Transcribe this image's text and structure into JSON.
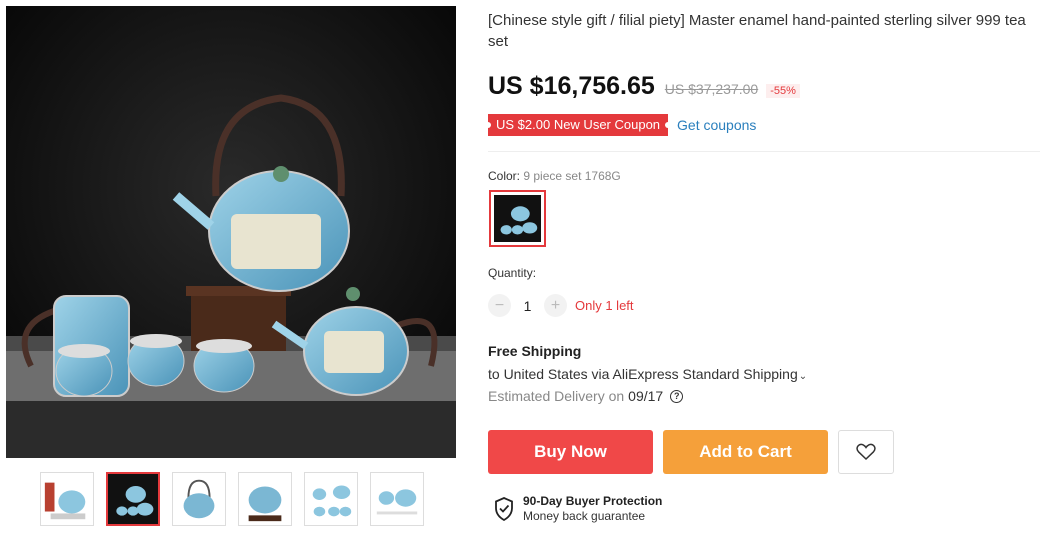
{
  "product": {
    "title": "[Chinese style gift / filial piety] Master enamel hand-painted sterling silver 999 tea set",
    "price": "US $16,756.65",
    "old_price": "US $37,237.00",
    "discount": "-55%",
    "coupon": "US $2.00 New User Coupon",
    "get_coupons": "Get coupons"
  },
  "options": {
    "color_label": "Color:",
    "color_value": "9 piece set 1768G",
    "quantity_label": "Quantity:",
    "quantity": "1",
    "minus": "−",
    "plus": "+",
    "stock_note": "Only 1 left"
  },
  "shipping": {
    "title": "Free Shipping",
    "line": "to United States via AliExpress Standard Shipping",
    "delivery_label": "Estimated Delivery on",
    "delivery_date": "09/17",
    "help": "?"
  },
  "actions": {
    "buy_now": "Buy Now",
    "add_to_cart": "Add to Cart"
  },
  "protection": {
    "title": "90-Day Buyer Protection",
    "subtitle": "Money back guarantee"
  },
  "gallery": {
    "thumbnail_count": 6,
    "active_index": 1
  },
  "colors": {
    "accent_red": "#e4393c",
    "buy_red": "#f04848",
    "cart_orange": "#f5a03a",
    "link_blue": "#2a7fbd"
  }
}
